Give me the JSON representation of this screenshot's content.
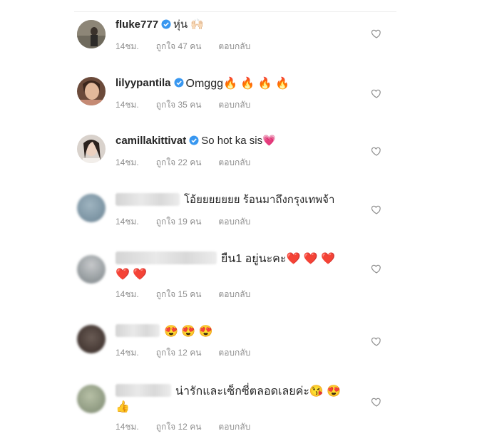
{
  "comments": [
    {
      "username": "fluke777",
      "verified": true,
      "name_hidden": false,
      "text": "หุ่น 🙌🏻",
      "time": "14ชม.",
      "likes": "ถูกใจ 47 คน",
      "reply": "ตอบกลับ"
    },
    {
      "username": "lilyypantila",
      "verified": true,
      "name_hidden": false,
      "text": "Omggg🔥 🔥 🔥 🔥",
      "time": "14ชม.",
      "likes": "ถูกใจ 35 คน",
      "reply": "ตอบกลับ"
    },
    {
      "username": "camillakittivat",
      "verified": true,
      "name_hidden": false,
      "text": "So hot ka sis💗",
      "time": "14ชม.",
      "likes": "ถูกใจ 22 คน",
      "reply": "ตอบกลับ"
    },
    {
      "username": "",
      "verified": false,
      "name_hidden": true,
      "text": "โอ้ยยยยยยย ร้อนมาถึงกรุงเทพจ้า",
      "time": "14ชม.",
      "likes": "ถูกใจ 19 คน",
      "reply": "ตอบกลับ"
    },
    {
      "username": "",
      "verified": false,
      "name_hidden": true,
      "text": "ยืน1 อยู่นะคะ❤️ ❤️ ❤️",
      "text2": "❤️ ❤️",
      "time": "14ชม.",
      "likes": "ถูกใจ 15 คน",
      "reply": "ตอบกลับ"
    },
    {
      "username": "",
      "verified": false,
      "name_hidden": true,
      "text": "😍 😍 😍",
      "time": "14ชม.",
      "likes": "ถูกใจ 12 คน",
      "reply": "ตอบกลับ"
    },
    {
      "username": "",
      "verified": false,
      "name_hidden": true,
      "text": "น่ารักและเซ็กซี่ตลอดเลยค่ะ😘 😍",
      "text2": "👍",
      "time": "14ชม.",
      "likes": "ถูกใจ 12 คน",
      "reply": "ตอบกลับ"
    }
  ],
  "colors": {
    "text": "#262626",
    "meta": "#8e8e8e",
    "verified": "#3897f0"
  },
  "icons": {
    "verified": "verified-badge-icon",
    "like": "heart-outline-icon"
  }
}
